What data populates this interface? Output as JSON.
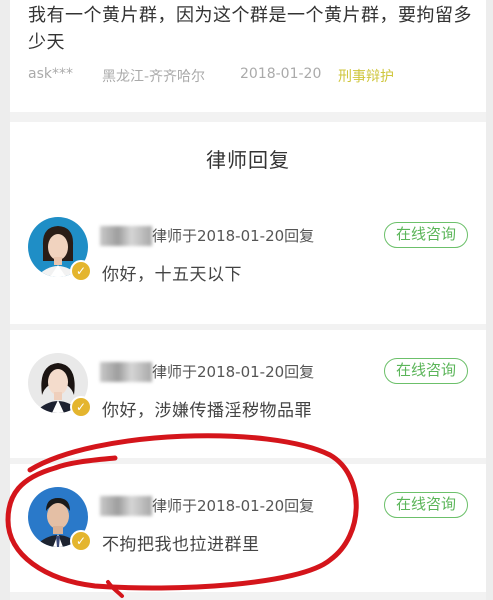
{
  "question": {
    "text": "我有一个黄片群，因为这个群是一个黄片群，要拘留多少天",
    "user": "ask***",
    "location": "黑龙江-齐齐哈尔",
    "date": "2018-01-20",
    "tag": "刑事辩护"
  },
  "replies_section": {
    "title": "律师回复",
    "items": [
      {
        "meta": "律师于2018-01-20回复",
        "consult_label": "在线咨询",
        "text": "你好，十五天以下"
      },
      {
        "meta": "律师于2018-01-20回复",
        "consult_label": "在线咨询",
        "text": "你好，涉嫌传播淫秽物品罪"
      },
      {
        "meta": "律师于2018-01-20回复",
        "consult_label": "在线咨询",
        "text": "不拘把我也拉进群里"
      }
    ]
  },
  "icons": {
    "verified_badge": "verified-check-icon",
    "avatar": "lawyer-avatar"
  },
  "colors": {
    "accent_green": "#5bb559",
    "tag_yellow": "#cfc63c",
    "badge_gold": "#e4b52e",
    "annotation_red": "#d4151b"
  }
}
